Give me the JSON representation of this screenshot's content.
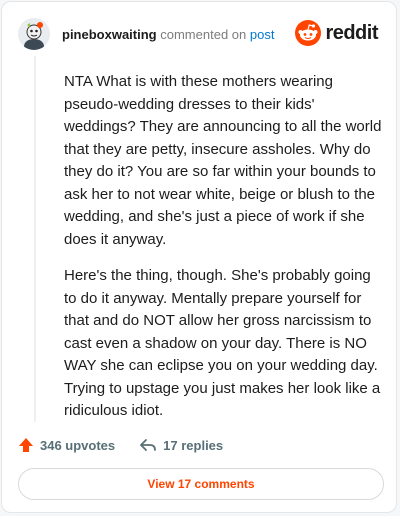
{
  "header": {
    "username": "pineboxwaiting",
    "verb": "commented on",
    "post_link": "post",
    "brand": "reddit"
  },
  "comment": {
    "paragraphs": [
      "NTA What is with these mothers wearing pseudo-wedding dresses to their kids' weddings? They are announcing to all the world that they are petty, insecure assholes. Why do they do it? You are so far within your bounds to ask her to not wear white, beige or blush to the wedding, and she's just a piece of work if she does it anyway.",
      "Here's the thing, though. She's probably going to do it anyway. Mentally prepare yourself for that and do NOT allow her gross narcissism to cast even a shadow on your day. There is NO WAY she can eclipse you on your wedding day. Trying to upstage you just makes her look like a ridiculous idiot."
    ]
  },
  "actions": {
    "upvotes": "346 upvotes",
    "replies": "17 replies"
  },
  "footer": {
    "view_label": "View 17 comments"
  },
  "colors": {
    "accent": "#ff4500",
    "link": "#0079d3",
    "muted": "#576f76"
  },
  "icons": [
    "avatar",
    "reddit-logo-icon",
    "upvote-arrow-icon",
    "reply-icon"
  ]
}
